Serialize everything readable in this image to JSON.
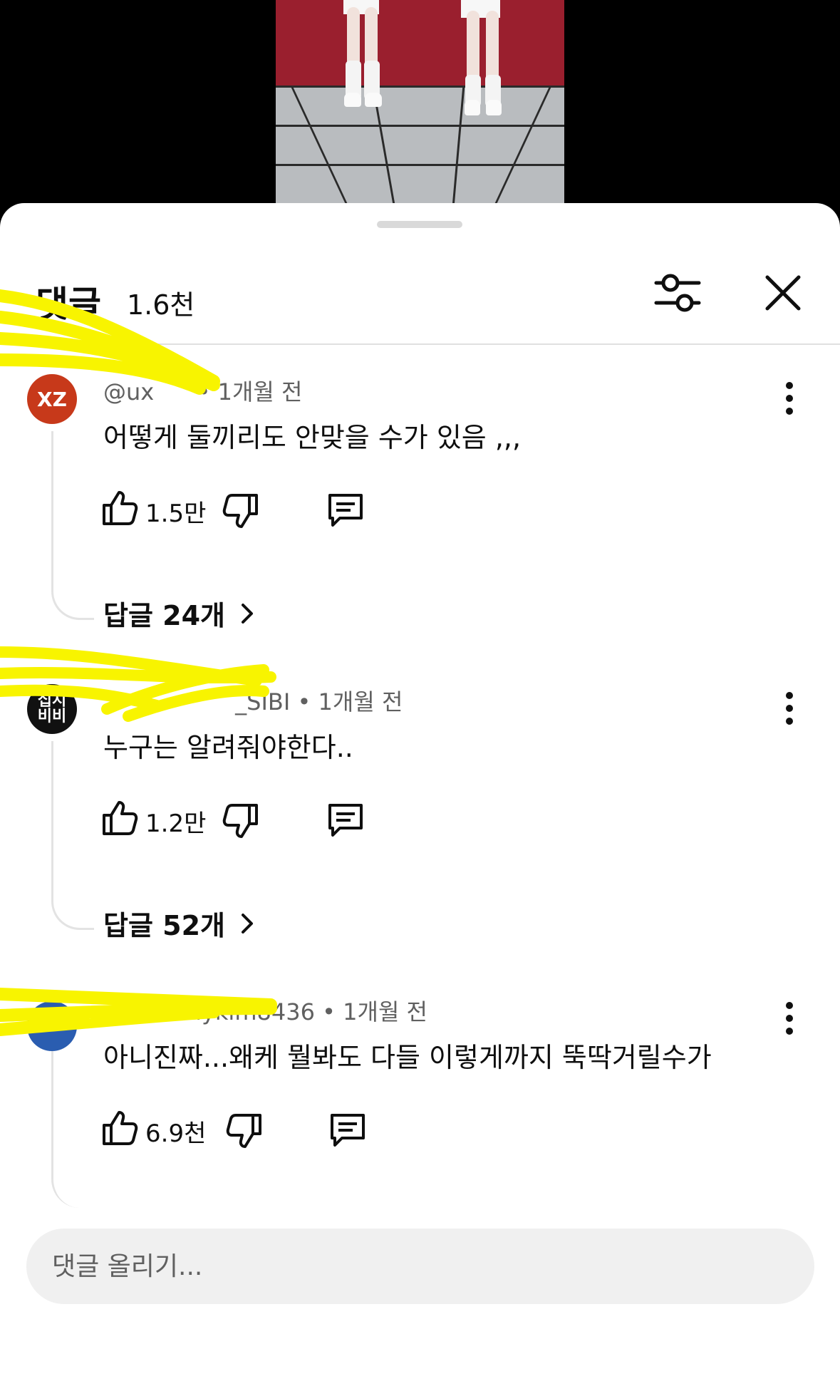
{
  "header": {
    "title": "댓글",
    "count": "1.6천"
  },
  "comments": [
    {
      "avatar_text": "XZ",
      "avatar_color": "#c7391a",
      "author": "@ux",
      "time": "• 1개월 전",
      "text": "어떻게 둘끼리도 안맞을 수가 있음 ,,,",
      "likes": "1.5만",
      "replies": "답글 24개"
    },
    {
      "avatar_text": "십시비비",
      "avatar_color": "#111111",
      "author": "_SIBI",
      "time": "• 1개월 전",
      "text": "누구는 알려줘야한다..",
      "likes": "1.2만",
      "replies": "답글 52개"
    },
    {
      "avatar_text": "",
      "avatar_color": "#2a5db0",
      "author": "llykim8436",
      "time": "• 1개월 전",
      "text": "아니진짜...왜케 뭘봐도 다들 이렇게까지 뚝딱거릴수가",
      "likes": "6.9천"
    }
  ],
  "input": {
    "placeholder": "댓글 올리기..."
  },
  "colors": {
    "highlight_scribble": "#f8f400",
    "sheet_background": "#ffffff"
  }
}
